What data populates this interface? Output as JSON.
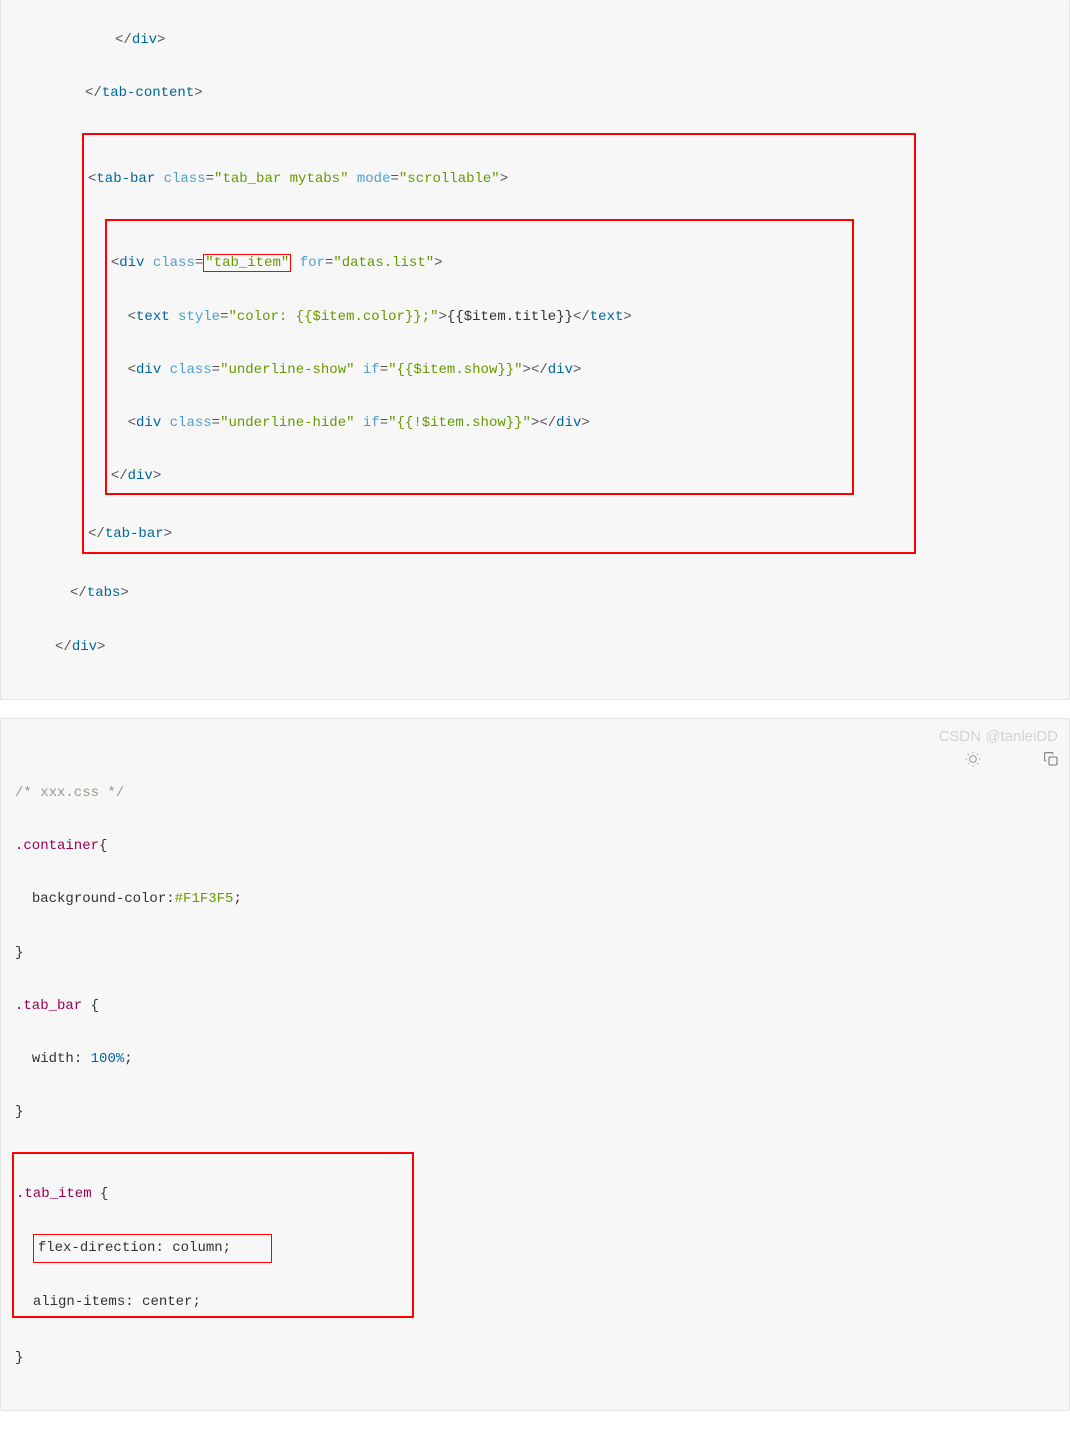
{
  "block1": {
    "l1_close_div": "div",
    "l2_close_tabcontent": "tab-content",
    "l3_open_tabbar": "tab-bar",
    "l3_attr_class": "class",
    "l3_val_class": "\"tab_bar mytabs\"",
    "l3_attr_mode": "mode",
    "l3_val_mode": "\"scrollable\"",
    "l4_tag": "div",
    "l4_attr_class": "class",
    "l4_eq": "=",
    "l4_val_class": "\"tab_item\"",
    "l4_attr_for": "for",
    "l4_val_for": "\"datas.list\"",
    "l5_tag": "text",
    "l5_attr_style": "style",
    "l5_val_style": "\"color: {{$item.color}};\"",
    "l5_text": "{{$item.title}}",
    "l6_tag": "div",
    "l6_attr_class": "class",
    "l6_val_class": "\"underline-show\"",
    "l6_attr_if": "if",
    "l6_val_if": "\"{{$item.show}}\"",
    "l7_tag": "div",
    "l7_attr_class": "class",
    "l7_val_class": "\"underline-hide\"",
    "l7_attr_if": "if",
    "l7_val_if": "\"{{!$item.show}}\"",
    "l8_close_div": "div",
    "l9_close_tabbar": "tab-bar",
    "l10_close_tabs": "tabs",
    "l11_close_div": "div"
  },
  "block2": {
    "comment": "/* xxx.css */",
    "sel_container": ".container",
    "prop_bg": "background-color",
    "val_bg": "#F1F3F5",
    "sel_tabbar": ".tab_bar",
    "prop_width": "width",
    "val_width": "100%",
    "sel_tabitem": ".tab_item",
    "prop_flexdir": "flex-direction",
    "val_flexdir": "column",
    "prop_align": "align-items",
    "val_align": "center"
  },
  "watermark": "CSDN @tanleiDD"
}
